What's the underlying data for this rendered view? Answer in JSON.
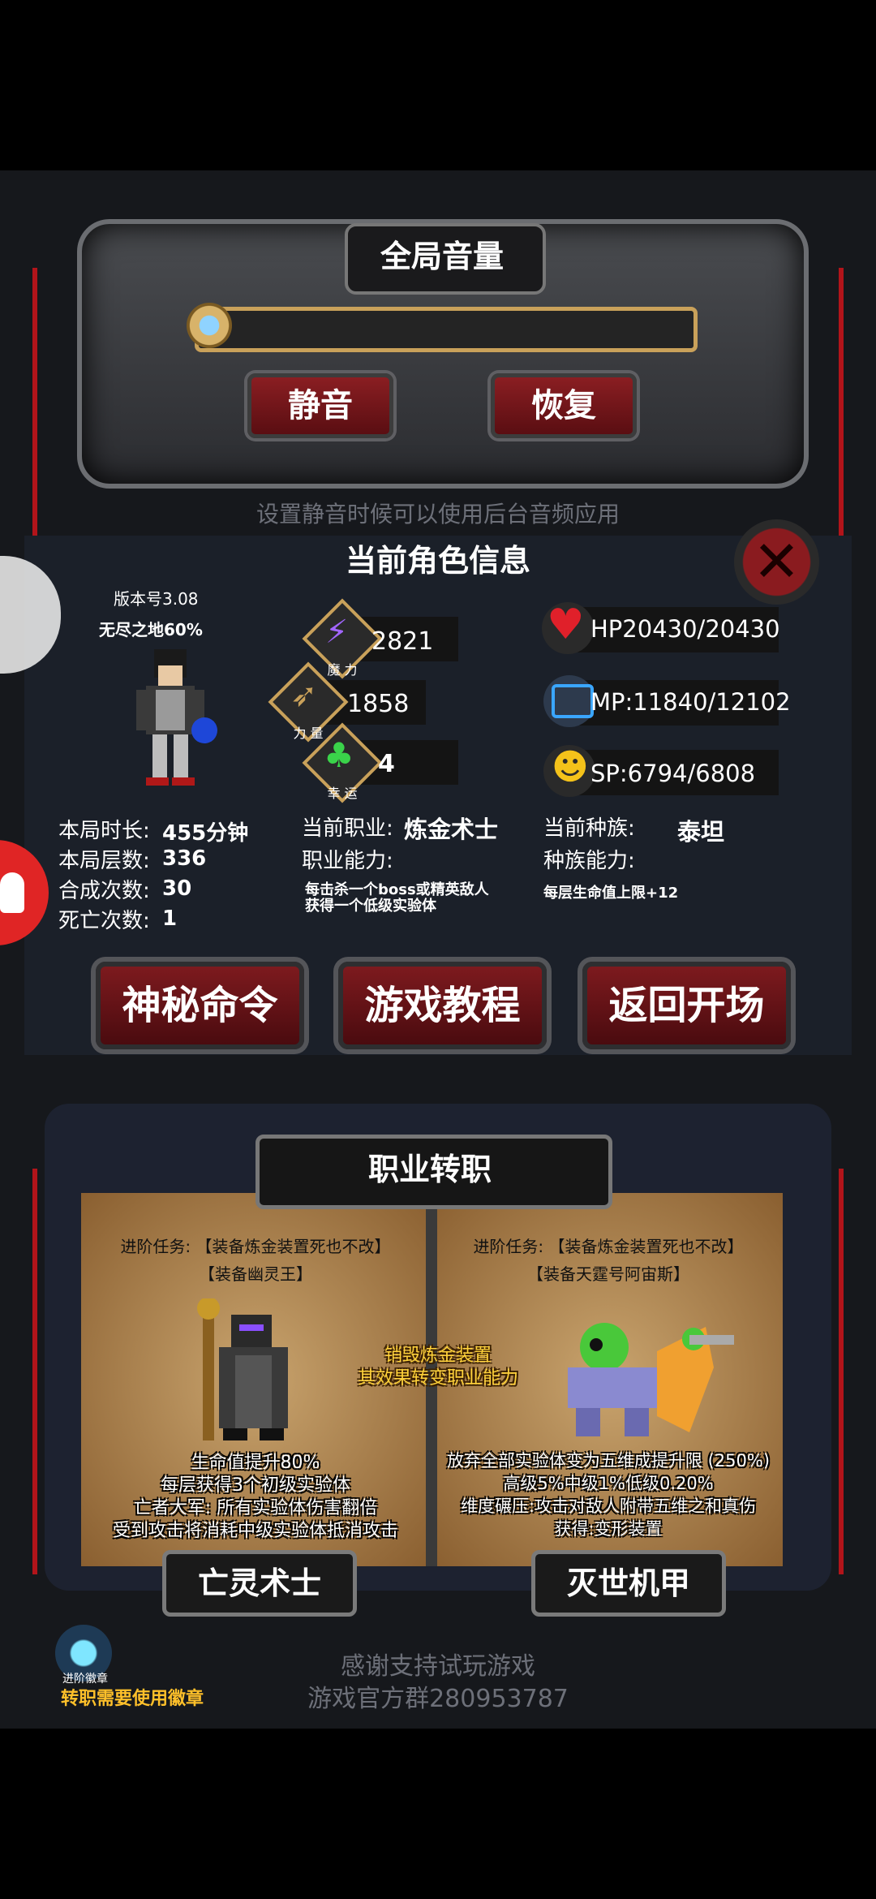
{
  "volume": {
    "title": "全局音量",
    "mute_label": "静音",
    "restore_label": "恢复",
    "hint": "设置静音时候可以使用后台音频应用"
  },
  "role_info": {
    "title": "当前角色信息",
    "version": "版本号3.08",
    "mode": "无尽之地60%",
    "stats": {
      "magic": {
        "label": "魔 力",
        "value": "2821"
      },
      "power": {
        "label": "力 量",
        "value": "1858"
      },
      "luck": {
        "label": "幸 运",
        "value": "4"
      }
    },
    "vitals": {
      "hp": "HP20430/20430",
      "mp": "MP:11840/12102",
      "sp": "SP:6794/6808"
    },
    "session": [
      {
        "label": "本局时长:",
        "value": "455分钟"
      },
      {
        "label": "本局层数:",
        "value": "336"
      },
      {
        "label": "合成次数:",
        "value": "30"
      },
      {
        "label": "死亡次数:",
        "value": "1"
      }
    ],
    "job": {
      "label": "当前职业:",
      "value": "炼金术士",
      "ability_label": "职业能力:",
      "ability_desc_1": "每击杀一个boss或精英敌人",
      "ability_desc_2": "获得一个低级实验体"
    },
    "race": {
      "label": "当前种族:",
      "value": "泰坦",
      "ability_label": "种族能力:",
      "ability_desc": "每层生命值上限+12"
    }
  },
  "actions": {
    "mystery": "神秘命令",
    "tutorial": "游戏教程",
    "back": "返回开场"
  },
  "job_change": {
    "title": "职业转职",
    "center_note_1": "销毁炼金装置",
    "center_note_2": "其效果转变职业能力",
    "left": {
      "task_1": "进阶任务: 【装备炼金装置死也不改】",
      "task_2": "【装备幽灵王】",
      "desc_1": "生命值提升80%",
      "desc_2": "每层获得3个初级实验体",
      "desc_3": "亡者大军: 所有实验体伤害翻倍",
      "desc_4": "受到攻击将消耗中级实验体抵消攻击",
      "name": "亡灵术士"
    },
    "right": {
      "task_1": "进阶任务: 【装备炼金装置死也不改】",
      "task_2": "【装备天霆号阿宙斯】",
      "desc_1": "放弃全部实验体变为五维成提升限 (250%)",
      "desc_2": "高级5%中级1%低级0.20%",
      "desc_3": "维度碾压:攻击对敌人附带五维之和真伤",
      "desc_4": "获得:变形装置",
      "name": "灭世机甲"
    }
  },
  "footer": {
    "badge_label": "进阶徽章",
    "badge_hint": "转职需要使用徽章",
    "thanks": "感谢支持试玩游戏",
    "group": "游戏官方群280953787"
  }
}
